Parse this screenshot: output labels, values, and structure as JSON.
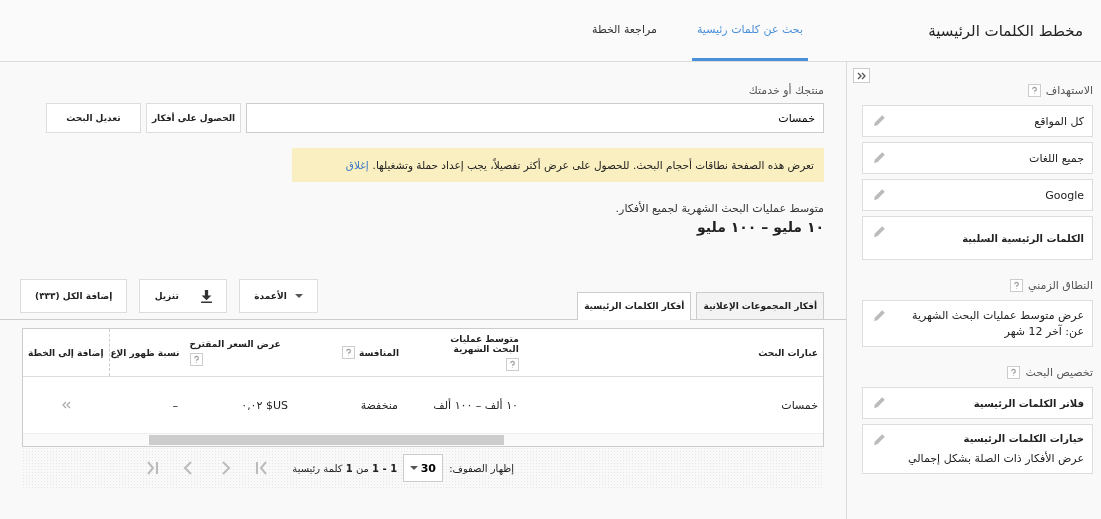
{
  "header": {
    "title": "مخطط الكلمات الرئيسية",
    "tabs": [
      {
        "label": "بحث عن كلمات رئيسية",
        "selected": true
      },
      {
        "label": "مراجعة الخطة",
        "selected": false
      }
    ]
  },
  "sidebar": {
    "sections": [
      {
        "title": "الاستهداف",
        "cards": [
          {
            "lines": [
              "كل المواقع"
            ],
            "bold": false
          },
          {
            "lines": [
              "جميع اللغات"
            ],
            "bold": false
          },
          {
            "lines": [
              "Google"
            ],
            "bold": false
          },
          {
            "lines": [
              "الكلمات الرئيسية السلبية"
            ],
            "bold": true
          }
        ]
      },
      {
        "title": "النطاق الزمني",
        "cards": [
          {
            "lines": [
              "عرض متوسط عمليات البحث الشهرية",
              "عن: آخر 12 شهر"
            ],
            "bold": false
          }
        ]
      },
      {
        "title": "تخصيص البحث",
        "cards": [
          {
            "lines": [
              "فلاتر الكلمات الرئيسية"
            ],
            "bold": true
          },
          {
            "lines": [
              "خيارات الكلمات الرئيسية"
            ],
            "bold": true,
            "detail": "عرض الأفكار ذات الصلة بشكل إجمالي"
          }
        ]
      }
    ]
  },
  "search": {
    "label": "منتجك أو خدمتك",
    "value": "خمسات",
    "buttons": [
      "الحصول على أفكار",
      "تعديل البحث"
    ]
  },
  "notice": {
    "text": "تعرض هذه الصفحة نطاقات أحجام البحث. للحصول على عرض أكثر تفصيلاً، يجب إعداد حملة وتشغيلها.",
    "link": "إغلاق"
  },
  "summary": {
    "label": "متوسط عمليات البحث الشهرية لجميع الأفكار.",
    "value": "١٠ مليو – ١٠٠ مليو"
  },
  "result_tabs": [
    {
      "label": "أفكار المجموعات الإعلانية",
      "selected": false
    },
    {
      "label": "أفكار الكلمات الرئيسية",
      "selected": true
    }
  ],
  "toolbar": {
    "columns": "الأعمدة",
    "download": "تنزيل",
    "add_all": "إضافة الكل (٣٣٣)"
  },
  "table": {
    "columns": [
      {
        "label": "عبارات البحث",
        "help": false
      },
      {
        "label": "متوسط عمليات البحث الشهرية",
        "help": true
      },
      {
        "label": "المنافسة",
        "help": true
      },
      {
        "label": "عرض السعر المقترح",
        "help": true
      },
      {
        "label": "نسبة ظهور الإع",
        "help": false
      },
      {
        "label": "إضافة إلى الخطة",
        "help": false
      }
    ],
    "rows": [
      {
        "cells": [
          "خمسات",
          "١٠ ألف – ١٠٠ ألف",
          "منخفضة",
          "US$ ٠,٠٢",
          "–"
        ]
      }
    ]
  },
  "pagination": {
    "rows_label": "إظهار الصفوف:",
    "rows_value": "30",
    "range": "**1 - 1** من **1** كلمة رئيسية"
  }
}
